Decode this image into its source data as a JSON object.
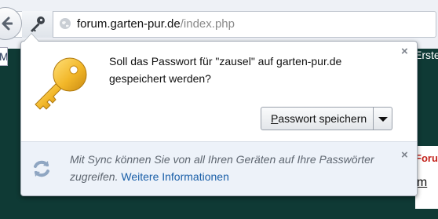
{
  "browser": {
    "url_domain": "forum.garten-pur.de",
    "url_path": "/index.php",
    "edge_tab_label": "M",
    "edge_right_text": "Erste"
  },
  "page_behind": {
    "forum_label": "Foru",
    "underline_text": "um"
  },
  "password_panel": {
    "message": "Soll das Passwort für \"zausel\" auf garten-pur.de gespeichert werden?",
    "save_access_key": "P",
    "save_rest": "asswort speichern",
    "close_glyph": "×"
  },
  "sync": {
    "text": "Mit Sync können Sie von all Ihren Geräten auf Ihre Passwörter zugreifen.",
    "link": "Weitere Informationen",
    "close_glyph": "×"
  },
  "colors": {
    "page_background": "#0f3a35",
    "link": "#1a5fa8",
    "key_gold": "#f2b729"
  },
  "icons": [
    "back-arrow-icon",
    "key-icon",
    "globe-icon",
    "password-key-icon",
    "dropdown-icon",
    "sync-icon",
    "close-icon"
  ]
}
